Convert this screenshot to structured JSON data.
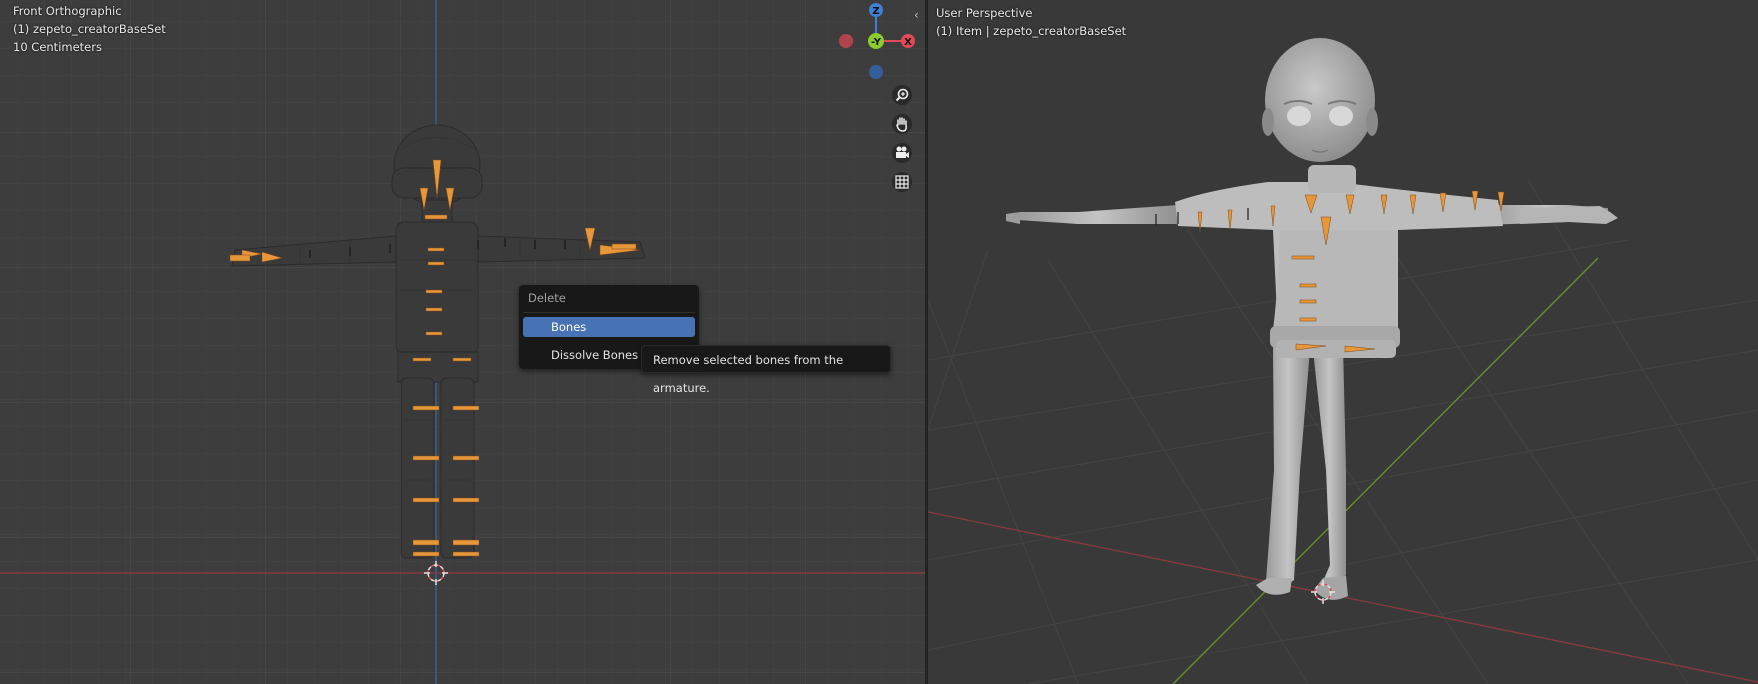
{
  "left_viewport": {
    "view_name": "Front Orthographic",
    "collection_line": "(1) zepeto_creatorBaseSet",
    "scale_line": "10 Centimeters"
  },
  "right_viewport": {
    "view_name": "User Perspective",
    "collection_line": "(1) Item | zepeto_creatorBaseSet"
  },
  "gizmo": {
    "z_label": "Z",
    "y_label": "-Y",
    "x_label": "X"
  },
  "nav_controls": [
    "zoom-icon",
    "hand-pan-icon",
    "camera-icon",
    "grid-icon"
  ],
  "context_menu": {
    "title": "Delete",
    "items": [
      {
        "label": "Bones",
        "active": true
      },
      {
        "label": "Dissolve Bones",
        "active": false
      }
    ]
  },
  "tooltip": {
    "text": "Remove selected bones from the armature."
  },
  "colors": {
    "axis_x": "#e34a57",
    "axis_y": "#8ccc2a",
    "axis_z": "#3f7fd6",
    "highlight": "#4772b3",
    "bone": "#e8963a"
  }
}
